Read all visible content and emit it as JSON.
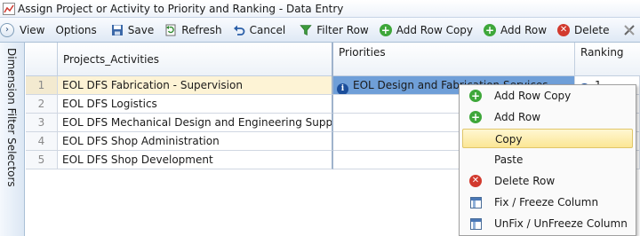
{
  "window": {
    "title": "Assign Project or Activity to Priority and Ranking - Data Entry"
  },
  "toolbar": {
    "items": [
      {
        "label": "View",
        "icon": "none"
      },
      {
        "label": "Options",
        "icon": "none"
      },
      {
        "label": "Save",
        "icon": "save-icon"
      },
      {
        "label": "Refresh",
        "icon": "refresh-icon"
      },
      {
        "label": "Cancel",
        "icon": "undo-icon"
      },
      {
        "label": "Filter Row",
        "icon": "filter-icon"
      },
      {
        "label": "Add Row Copy",
        "icon": "add-icon"
      },
      {
        "label": "Add Row",
        "icon": "add-icon"
      },
      {
        "label": "Delete",
        "icon": "delete-icon"
      }
    ]
  },
  "sidepanel": {
    "label": "Dimension Filter Selectors"
  },
  "grid": {
    "columns": [
      "Projects_Activities",
      "Priorities",
      "Ranking"
    ],
    "rows": [
      {
        "num": "1",
        "project": "EOL DFS Fabrication - Supervision",
        "priority": "EOL Design and Fabrication Services",
        "ranking": "1"
      },
      {
        "num": "2",
        "project": "EOL DFS Logistics",
        "priority": "",
        "ranking": ""
      },
      {
        "num": "3",
        "project": "EOL DFS Mechanical Design and Engineering Support",
        "priority": "",
        "ranking": ""
      },
      {
        "num": "4",
        "project": "EOL DFS Shop Administration",
        "priority": "",
        "ranking": ""
      },
      {
        "num": "5",
        "project": "EOL DFS Shop Development",
        "priority": "",
        "ranking": ""
      }
    ]
  },
  "context_menu": {
    "items": [
      {
        "label": "Add Row Copy",
        "icon": "add-icon"
      },
      {
        "label": "Add Row",
        "icon": "add-icon"
      },
      {
        "label": "Copy",
        "icon": "none"
      },
      {
        "label": "Paste",
        "icon": "none"
      },
      {
        "label": "Delete Row",
        "icon": "delete-icon"
      },
      {
        "label": "Fix / Freeze Column",
        "icon": "column-icon"
      },
      {
        "label": "UnFix / UnFreeze Column",
        "icon": "column-icon"
      }
    ]
  },
  "colors": {
    "selected_row": "#fdf3d5",
    "active_cell": "#6f9fd8",
    "menu_highlight": "#fbe694"
  }
}
